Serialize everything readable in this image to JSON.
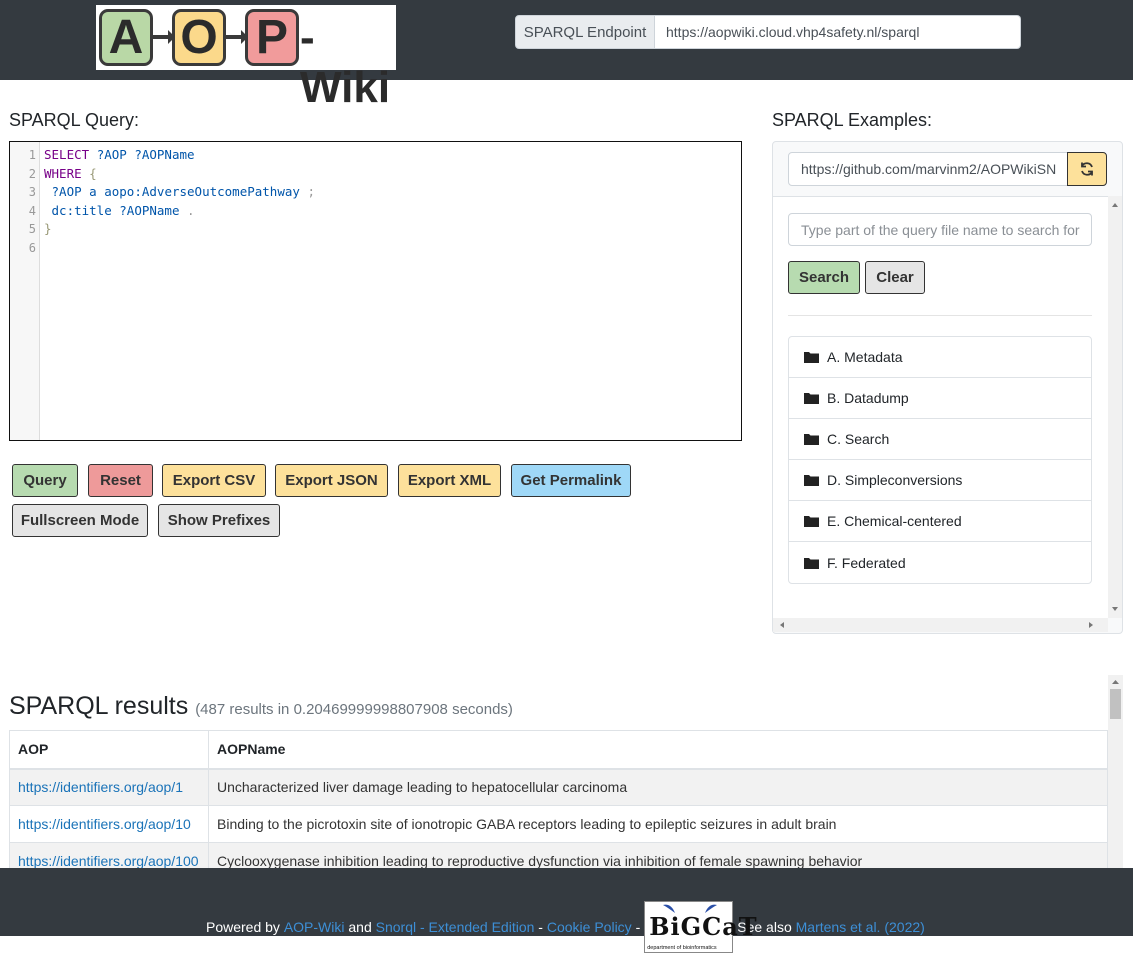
{
  "header": {
    "logo": {
      "a": "A",
      "o": "O",
      "p": "P",
      "suffix": "-Wiki"
    },
    "endpoint_label": "SPARQL Endpoint",
    "endpoint_value": "https://aopwiki.cloud.vhp4safety.nl/sparql"
  },
  "query": {
    "heading": "SPARQL Query:",
    "line_numbers": [
      "1",
      "2",
      "3",
      "4",
      "5",
      "6"
    ],
    "tokens": {
      "select": "SELECT",
      "aop1": "?AOP",
      "aopname1": "?AOPName",
      "where": "WHERE",
      "open_brace": "{",
      "aop2": "?AOP",
      "a": "a",
      "class": "aopo:AdverseOutcomePathway",
      "semicolon": ";",
      "dctitle": "dc:title",
      "aopname2": "?AOPName",
      "dot": ".",
      "close_brace": "}"
    }
  },
  "buttons": {
    "query": "Query",
    "reset": "Reset",
    "export_csv": "Export CSV",
    "export_json": "Export JSON",
    "export_xml": "Export XML",
    "permalink": "Get Permalink",
    "fullscreen": "Fullscreen Mode",
    "prefixes": "Show Prefixes"
  },
  "examples": {
    "heading": "SPARQL Examples:",
    "repo_url": "https://github.com/marvinm2/AOPWikiSN",
    "search_placeholder": "Type part of the query file name to search for",
    "search_button": "Search",
    "clear_button": "Clear",
    "folders": [
      "A. Metadata",
      "B. Datadump",
      "C. Search",
      "D. Simpleconversions",
      "E. Chemical-centered",
      "F. Federated"
    ]
  },
  "results": {
    "title": "SPARQL results",
    "meta": "(487 results in 0.20469999998807908 seconds)",
    "columns": [
      "AOP",
      "AOPName"
    ],
    "rows": [
      {
        "aop": "https://identifiers.org/aop/1",
        "name": "Uncharacterized liver damage leading to hepatocellular carcinoma"
      },
      {
        "aop": "https://identifiers.org/aop/10",
        "name": "Binding to the picrotoxin site of ionotropic GABA receptors leading to epileptic seizures in adult brain"
      },
      {
        "aop": "https://identifiers.org/aop/100",
        "name": "Cyclooxygenase inhibition leading to reproductive dysfunction via inhibition of female spawning behavior"
      }
    ]
  },
  "footer": {
    "powered_by": "Powered by",
    "aopwiki": "AOP-Wiki",
    "and": "and",
    "snorql": "Snorql - Extended Edition",
    "dash1": "-",
    "cookie": "Cookie Policy",
    "dash2": "-",
    "bigcat_text": "BiGCaT",
    "bigcat_sub": "department of bioinformatics",
    "see_also": "See also",
    "martens": "Martens et al. (2022)"
  },
  "colors": {
    "header_bg": "#343a40",
    "link": "#1a73b8",
    "green": "#b7dbb0",
    "red": "#ee9a9a",
    "yellow": "#fde19b",
    "blue": "#9fd8f7"
  }
}
